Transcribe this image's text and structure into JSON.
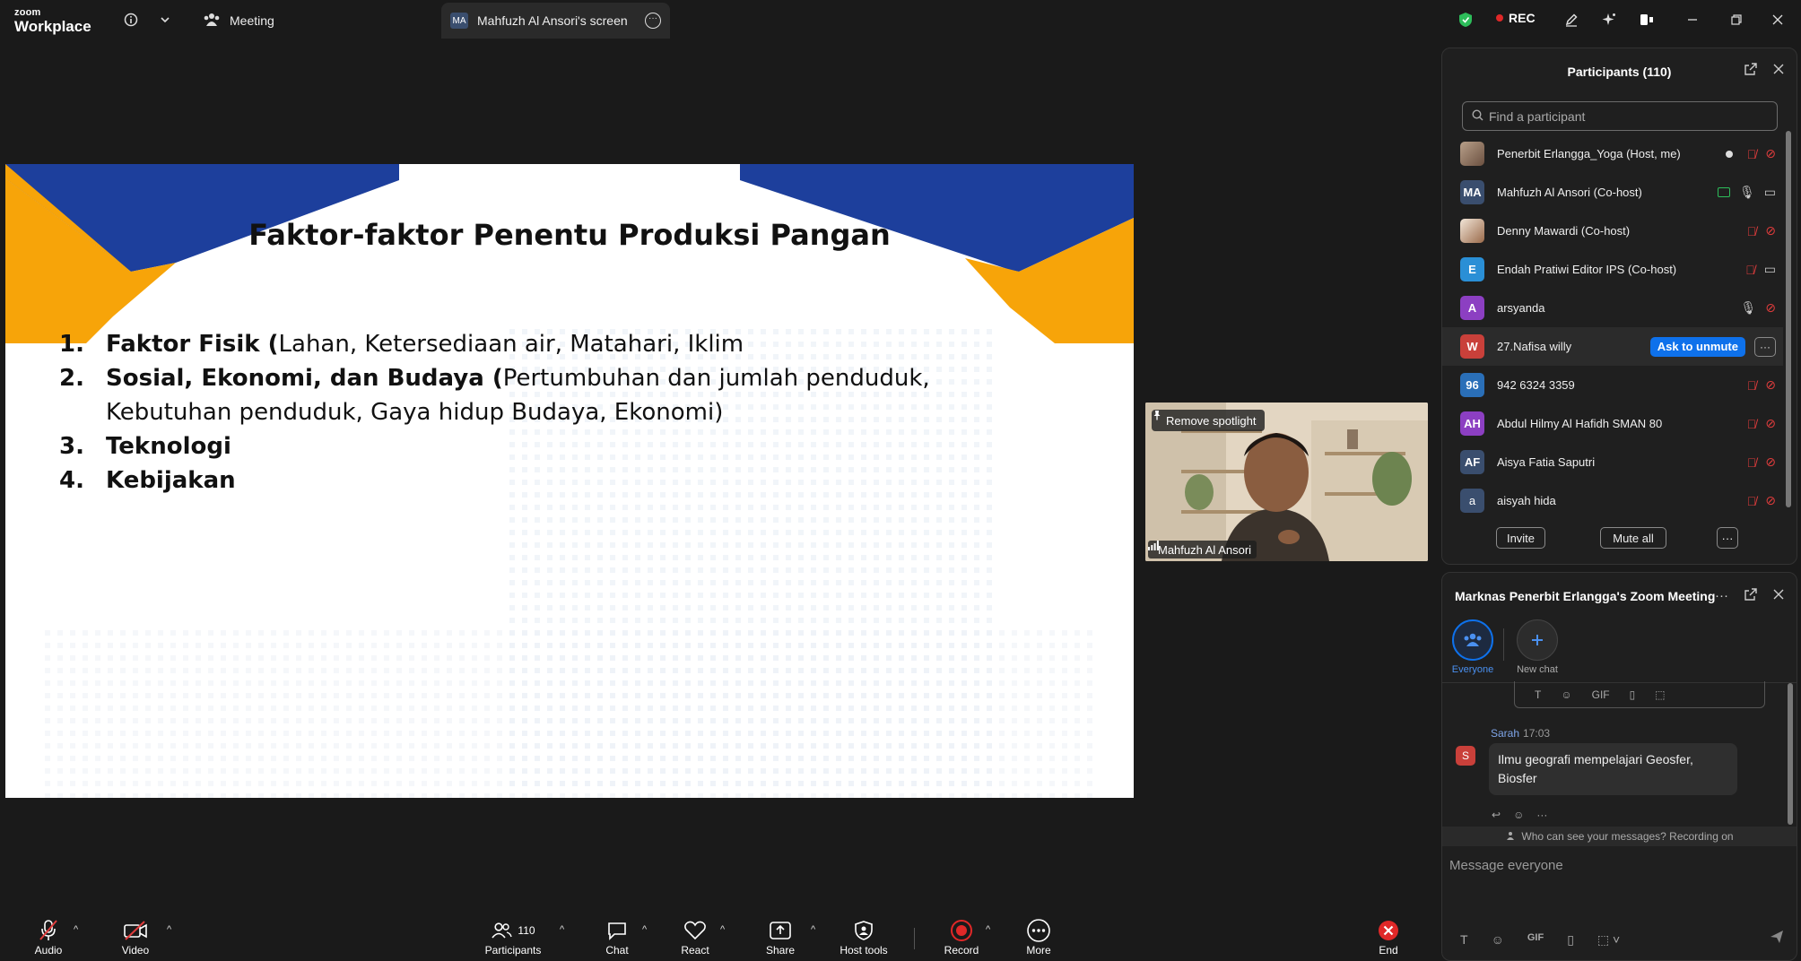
{
  "app": {
    "logo_top": "zoom",
    "logo_bottom": "Workplace"
  },
  "tabs": {
    "meeting": "Meeting",
    "screen_avatar": "MA",
    "screen": "Mahfuzh Al Ansori's screen"
  },
  "status": {
    "rec": "REC",
    "colors": {
      "rec": "#e02828",
      "shield": "#2dbd5a",
      "accent": "#0e71eb"
    }
  },
  "slide": {
    "title": "Faktor-faktor Penentu Produksi Pangan",
    "items": [
      {
        "num": "1.",
        "bold": "Faktor Fisik (",
        "rest": "Lahan, Ketersediaan air, Matahari, Iklim"
      },
      {
        "num": "2.",
        "bold": "Sosial, Ekonomi, dan Budaya (",
        "rest": "Pertumbuhan dan jumlah penduduk, Kebutuhan penduduk, Gaya hidup Budaya, Ekonomi)"
      },
      {
        "num": "3.",
        "bold": "Teknologi",
        "rest": ""
      },
      {
        "num": "4.",
        "bold": "Kebijakan",
        "rest": ""
      }
    ]
  },
  "video": {
    "spotlight": "Remove spotlight",
    "name": "Mahfuzh Al Ansori"
  },
  "participants": {
    "title": "Participants (110)",
    "search_placeholder": "Find a participant",
    "list": [
      {
        "avatar": "",
        "name": "Penerbit Erlangga_Yoga (Host, me)"
      },
      {
        "avatar": "MA",
        "name": "Mahfuzh Al Ansori (Co-host)"
      },
      {
        "avatar": "",
        "name": "Denny Mawardi (Co-host)"
      },
      {
        "avatar": "E",
        "name": "Endah Pratiwi Editor IPS (Co-host)"
      },
      {
        "avatar": "A",
        "name": "arsyanda"
      },
      {
        "avatar": "W",
        "name": "27.Nafisa willy"
      },
      {
        "avatar": "96",
        "name": "942 6324 3359"
      },
      {
        "avatar": "AH",
        "name": "Abdul Hilmy Al Hafidh SMAN 80"
      },
      {
        "avatar": "AF",
        "name": "Aisya Fatia Saputri"
      },
      {
        "avatar": "a",
        "name": "aisyah hida"
      }
    ],
    "ask_to_unmute": "Ask to unmute",
    "invite": "Invite",
    "mute_all": "Mute all"
  },
  "chat": {
    "title": "Marknas Penerbit Erlangga's Zoom Meeting",
    "tab_everyone": "Everyone",
    "tab_new_chat": "New chat",
    "sender": "Sarah",
    "sender_initial": "S",
    "time": "17:03",
    "message": "Ilmu geografi mempelajari Geosfer, Biosfer",
    "notice": "Who can see your messages? Recording on",
    "input_placeholder": "Message everyone",
    "gif": "GIF"
  },
  "toolbar": {
    "audio": "Audio",
    "video": "Video",
    "participants": "Participants",
    "participants_count": "110",
    "chat": "Chat",
    "react": "React",
    "share": "Share",
    "host_tools": "Host tools",
    "record": "Record",
    "more": "More",
    "end": "End"
  }
}
